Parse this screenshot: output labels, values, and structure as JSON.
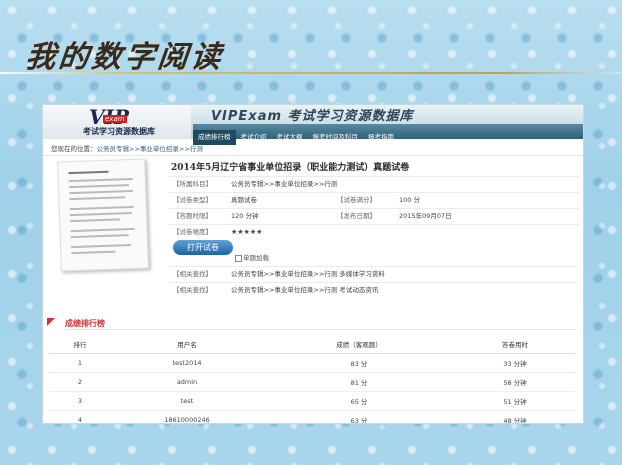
{
  "page_title": "我的数字阅读",
  "banner": {
    "logo_main": "VIP",
    "logo_badge": "exam",
    "logo_sub": "考试学习资源数据库",
    "title": "VIPExam 考试学习资源数据库"
  },
  "nav": [
    "成绩排行榜",
    "考试介绍",
    "考试大纲",
    "报考时间及科目",
    "报考指南"
  ],
  "breadcrumb": {
    "prefix": "您现在的位置：",
    "trail": "公务员专辑>>事业单位招录>>行测"
  },
  "exam": {
    "title": "2014年5月辽宁省事业单位招录（职业能力测试）真题试卷",
    "rows": [
      {
        "label": "【所属科目】",
        "value": "公务员专辑>>事业单位招录>>行测"
      },
      {
        "label": "【试卷类型】",
        "value": "真题试卷",
        "label2": "【试卷满分】",
        "value2": "100 分"
      },
      {
        "label": "【答题时限】",
        "value": "120 分钟",
        "label2": "【发布日期】",
        "value2": "2015年09月07日"
      },
      {
        "label": "【试卷难度】",
        "value": "★★★★★"
      },
      {
        "label": "【相关查找】",
        "value": "公务员专辑>>事业单位招录>>行测 多媒体学习资料"
      },
      {
        "label": "【相关查找】",
        "value": "公务员专辑>>事业单位招录>>行测 考试动态资讯"
      }
    ],
    "open_button": "打开试卷",
    "single_load": "单题加载"
  },
  "ranking": {
    "title": "成绩排行榜",
    "headers": [
      "排行",
      "用户名",
      "成绩（客观题）",
      "答卷用时"
    ],
    "rows": [
      [
        "1",
        "test2014",
        "83 分",
        "33 分钟"
      ],
      [
        "2",
        "admin",
        "81 分",
        "58 分钟"
      ],
      [
        "3",
        "test",
        "65 分",
        "51 分钟"
      ],
      [
        "4",
        "18610000246",
        "63 分",
        "48 分钟"
      ]
    ]
  }
}
